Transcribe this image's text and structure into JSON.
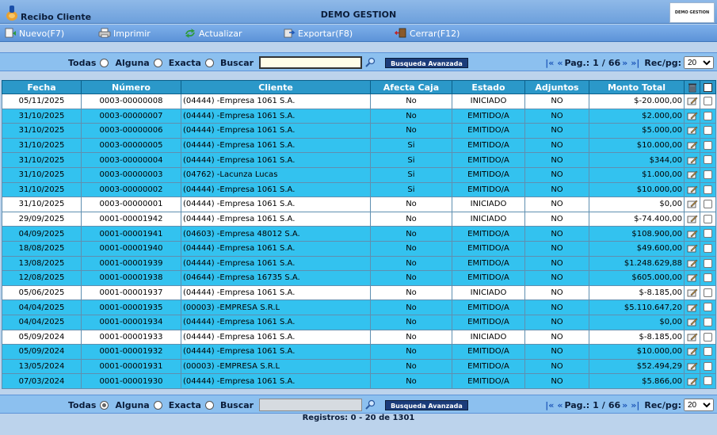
{
  "header": {
    "app_title": "Recibo Cliente",
    "company": "DEMO GESTION",
    "logo_text": "DEMO GESTION"
  },
  "toolbar": {
    "nuevo": "Nuevo(F7)",
    "imprimir": "Imprimir",
    "actualizar": "Actualizar",
    "exportar": "Exportar(F8)",
    "cerrar": "Cerrar(F12)"
  },
  "filters": {
    "todas": "Todas",
    "alguna": "Alguna",
    "exacta": "Exacta",
    "buscar": "Buscar",
    "search_value": "",
    "advanced": "Busqueda Avanzada"
  },
  "pager": {
    "first": "|«",
    "prev": "«",
    "page_label": "Pag.:",
    "page": "1",
    "of": "/",
    "total_pages": "66",
    "next": "»",
    "last": "»|",
    "rec_label": "Rec/pg:",
    "rec_value": "20"
  },
  "table": {
    "headers": [
      "Fecha",
      "Número",
      "Cliente",
      "Afecta Caja",
      "Estado",
      "Adjuntos",
      "Monto Total"
    ],
    "rows": [
      {
        "fecha": "05/11/2025",
        "numero": "0003-00000008",
        "cliente": "(04444) -Empresa 1061 S.A.",
        "caja": "No",
        "estado": "INICIADO",
        "adjuntos": "NO",
        "monto": "$-20.000,00",
        "style": "white"
      },
      {
        "fecha": "31/10/2025",
        "numero": "0003-00000007",
        "cliente": "(04444) -Empresa 1061 S.A.",
        "caja": "No",
        "estado": "EMITIDO/A",
        "adjuntos": "NO",
        "monto": "$2.000,00",
        "style": "cyan"
      },
      {
        "fecha": "31/10/2025",
        "numero": "0003-00000006",
        "cliente": "(04444) -Empresa 1061 S.A.",
        "caja": "No",
        "estado": "EMITIDO/A",
        "adjuntos": "NO",
        "monto": "$5.000,00",
        "style": "cyan"
      },
      {
        "fecha": "31/10/2025",
        "numero": "0003-00000005",
        "cliente": "(04444) -Empresa 1061 S.A.",
        "caja": "Si",
        "estado": "EMITIDO/A",
        "adjuntos": "NO",
        "monto": "$10.000,00",
        "style": "cyan"
      },
      {
        "fecha": "31/10/2025",
        "numero": "0003-00000004",
        "cliente": "(04444) -Empresa 1061 S.A.",
        "caja": "Si",
        "estado": "EMITIDO/A",
        "adjuntos": "NO",
        "monto": "$344,00",
        "style": "cyan"
      },
      {
        "fecha": "31/10/2025",
        "numero": "0003-00000003",
        "cliente": "(04762) -Lacunza Lucas",
        "caja": "Si",
        "estado": "EMITIDO/A",
        "adjuntos": "NO",
        "monto": "$1.000,00",
        "style": "cyan"
      },
      {
        "fecha": "31/10/2025",
        "numero": "0003-00000002",
        "cliente": "(04444) -Empresa 1061 S.A.",
        "caja": "Si",
        "estado": "EMITIDO/A",
        "adjuntos": "NO",
        "monto": "$10.000,00",
        "style": "cyan"
      },
      {
        "fecha": "31/10/2025",
        "numero": "0003-00000001",
        "cliente": "(04444) -Empresa 1061 S.A.",
        "caja": "No",
        "estado": "INICIADO",
        "adjuntos": "NO",
        "monto": "$0,00",
        "style": "white"
      },
      {
        "fecha": "29/09/2025",
        "numero": "0001-00001942",
        "cliente": "(04444) -Empresa 1061 S.A.",
        "caja": "No",
        "estado": "INICIADO",
        "adjuntos": "NO",
        "monto": "$-74.400,00",
        "style": "white"
      },
      {
        "fecha": "04/09/2025",
        "numero": "0001-00001941",
        "cliente": "(04603) -Empresa 48012 S.A.",
        "caja": "No",
        "estado": "EMITIDO/A",
        "adjuntos": "NO",
        "monto": "$108.900,00",
        "style": "cyan"
      },
      {
        "fecha": "18/08/2025",
        "numero": "0001-00001940",
        "cliente": "(04444) -Empresa 1061 S.A.",
        "caja": "No",
        "estado": "EMITIDO/A",
        "adjuntos": "NO",
        "monto": "$49.600,00",
        "style": "cyan"
      },
      {
        "fecha": "13/08/2025",
        "numero": "0001-00001939",
        "cliente": "(04444) -Empresa 1061 S.A.",
        "caja": "No",
        "estado": "EMITIDO/A",
        "adjuntos": "NO",
        "monto": "$1.248.629,88",
        "style": "cyan"
      },
      {
        "fecha": "12/08/2025",
        "numero": "0001-00001938",
        "cliente": "(04644) -Empresa 16735 S.A.",
        "caja": "No",
        "estado": "EMITIDO/A",
        "adjuntos": "NO",
        "monto": "$605.000,00",
        "style": "cyan"
      },
      {
        "fecha": "05/06/2025",
        "numero": "0001-00001937",
        "cliente": "(04444) -Empresa 1061 S.A.",
        "caja": "No",
        "estado": "INICIADO",
        "adjuntos": "NO",
        "monto": "$-8.185,00",
        "style": "white"
      },
      {
        "fecha": "04/04/2025",
        "numero": "0001-00001935",
        "cliente": "(00003) -EMPRESA S.R.L",
        "caja": "No",
        "estado": "EMITIDO/A",
        "adjuntos": "NO",
        "monto": "$5.110.647,20",
        "style": "cyan"
      },
      {
        "fecha": "04/04/2025",
        "numero": "0001-00001934",
        "cliente": "(04444) -Empresa 1061 S.A.",
        "caja": "No",
        "estado": "EMITIDO/A",
        "adjuntos": "NO",
        "monto": "$0,00",
        "style": "cyan"
      },
      {
        "fecha": "05/09/2024",
        "numero": "0001-00001933",
        "cliente": "(04444) -Empresa 1061 S.A.",
        "caja": "No",
        "estado": "INICIADO",
        "adjuntos": "NO",
        "monto": "$-8.185,00",
        "style": "white"
      },
      {
        "fecha": "05/09/2024",
        "numero": "0001-00001932",
        "cliente": "(04444) -Empresa 1061 S.A.",
        "caja": "No",
        "estado": "EMITIDO/A",
        "adjuntos": "NO",
        "monto": "$10.000,00",
        "style": "cyan"
      },
      {
        "fecha": "13/05/2024",
        "numero": "0001-00001931",
        "cliente": "(00003) -EMPRESA S.R.L",
        "caja": "No",
        "estado": "EMITIDO/A",
        "adjuntos": "NO",
        "monto": "$52.494,29",
        "style": "cyan"
      },
      {
        "fecha": "07/03/2024",
        "numero": "0001-00001930",
        "cliente": "(04444) -Empresa 1061 S.A.",
        "caja": "No",
        "estado": "EMITIDO/A",
        "adjuntos": "NO",
        "monto": "$5.866,00",
        "style": "cyan"
      }
    ]
  },
  "footer": {
    "registros": "Registros: 0 - 20 de 1301"
  },
  "colors": {
    "row_cyan": "#33c2ef",
    "row_white": "#ffffff",
    "header": "#2b98c9",
    "toolbar": "#6da0dc"
  },
  "icons": {
    "app": "app-logo-icon",
    "nuevo": "new-document-icon",
    "imprimir": "printer-icon",
    "actualizar": "refresh-icon",
    "exportar": "export-icon",
    "cerrar": "close-door-icon",
    "search": "magnifier-icon",
    "trash": "trash-icon",
    "edit": "edit-icon"
  }
}
